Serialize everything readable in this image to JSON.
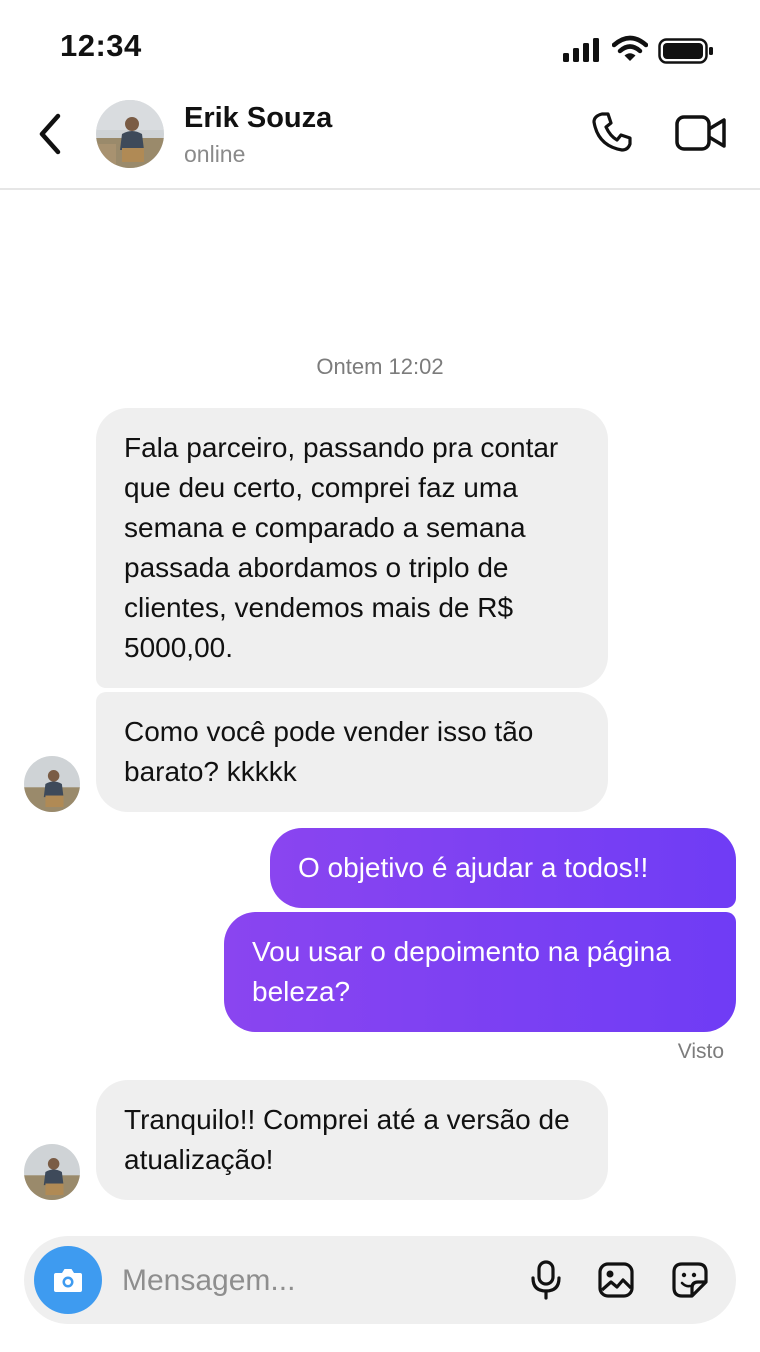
{
  "status_bar": {
    "time": "12:34"
  },
  "header": {
    "contact_name": "Erik Souza",
    "contact_status": "online"
  },
  "chat": {
    "timestamp": "Ontem 12:02",
    "messages": [
      {
        "direction": "incoming",
        "text": "Fala parceiro, passando pra contar que deu certo, comprei faz uma semana e comparado a semana passada abordamos o triplo de clientes, vendemos mais de R$ 5000,00."
      },
      {
        "direction": "incoming",
        "text": "Como você pode vender isso tão barato? kkkkk"
      },
      {
        "direction": "outgoing",
        "text": "O objetivo é ajudar a todos!!"
      },
      {
        "direction": "outgoing",
        "text": "Vou usar o depoimento na página beleza?"
      },
      {
        "direction": "incoming",
        "text": "Tranquilo!! Comprei até a versão de atualização!"
      }
    ],
    "seen_label": "Visto"
  },
  "composer": {
    "placeholder": "Mensagem..."
  },
  "colors": {
    "outgoing_bubble_start": "#8a45f0",
    "outgoing_bubble_end": "#6f3cf5",
    "incoming_bubble": "#efefef",
    "camera_button": "#3e9bf0"
  }
}
